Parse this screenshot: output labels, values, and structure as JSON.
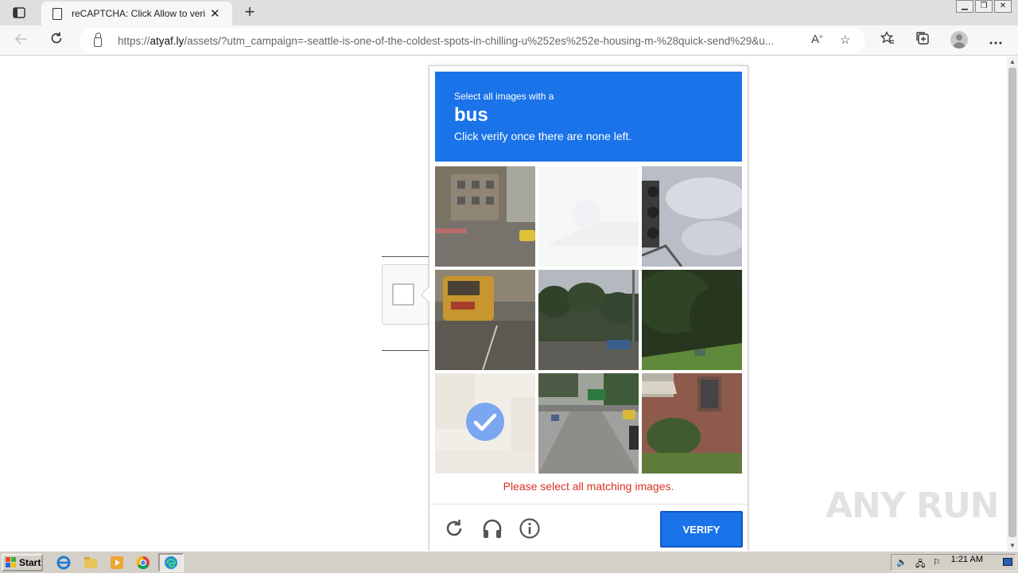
{
  "browser": {
    "tab_title": "reCAPTCHA: Click Allow to verify that you are not a robot",
    "url_prefix": "https://",
    "url_host": "atyaf.ly",
    "url_path": "/assets/?utm_campaign=-seattle-is-one-of-the-coldest-spots-in-chilling-u%252es%252e-housing-m-%28quick-send%29&u..."
  },
  "captcha": {
    "instruction_line1": "Select all images with a",
    "target_object": "bus",
    "instruction_line3": "Click verify once there are none left.",
    "error_message": "Please select all matching images.",
    "verify_label": "VERIFY",
    "tiles": [
      {
        "scene": "street-corner-building-yellow-car",
        "state": "unselected"
      },
      {
        "scene": "fading-out-selected",
        "state": "fading"
      },
      {
        "scene": "traffic-light-sky",
        "state": "unselected"
      },
      {
        "scene": "yellow-bus-road",
        "state": "unselected"
      },
      {
        "scene": "palm-trees-street",
        "state": "unselected"
      },
      {
        "scene": "trees-grass-hill",
        "state": "unselected"
      },
      {
        "scene": "faded-selected-street",
        "state": "selected"
      },
      {
        "scene": "highway-overpass-cars",
        "state": "unselected"
      },
      {
        "scene": "brick-house-garden",
        "state": "unselected"
      }
    ]
  },
  "watermark": "ANY RUN",
  "taskbar": {
    "start_label": "Start",
    "clock": "1:21 AM"
  }
}
